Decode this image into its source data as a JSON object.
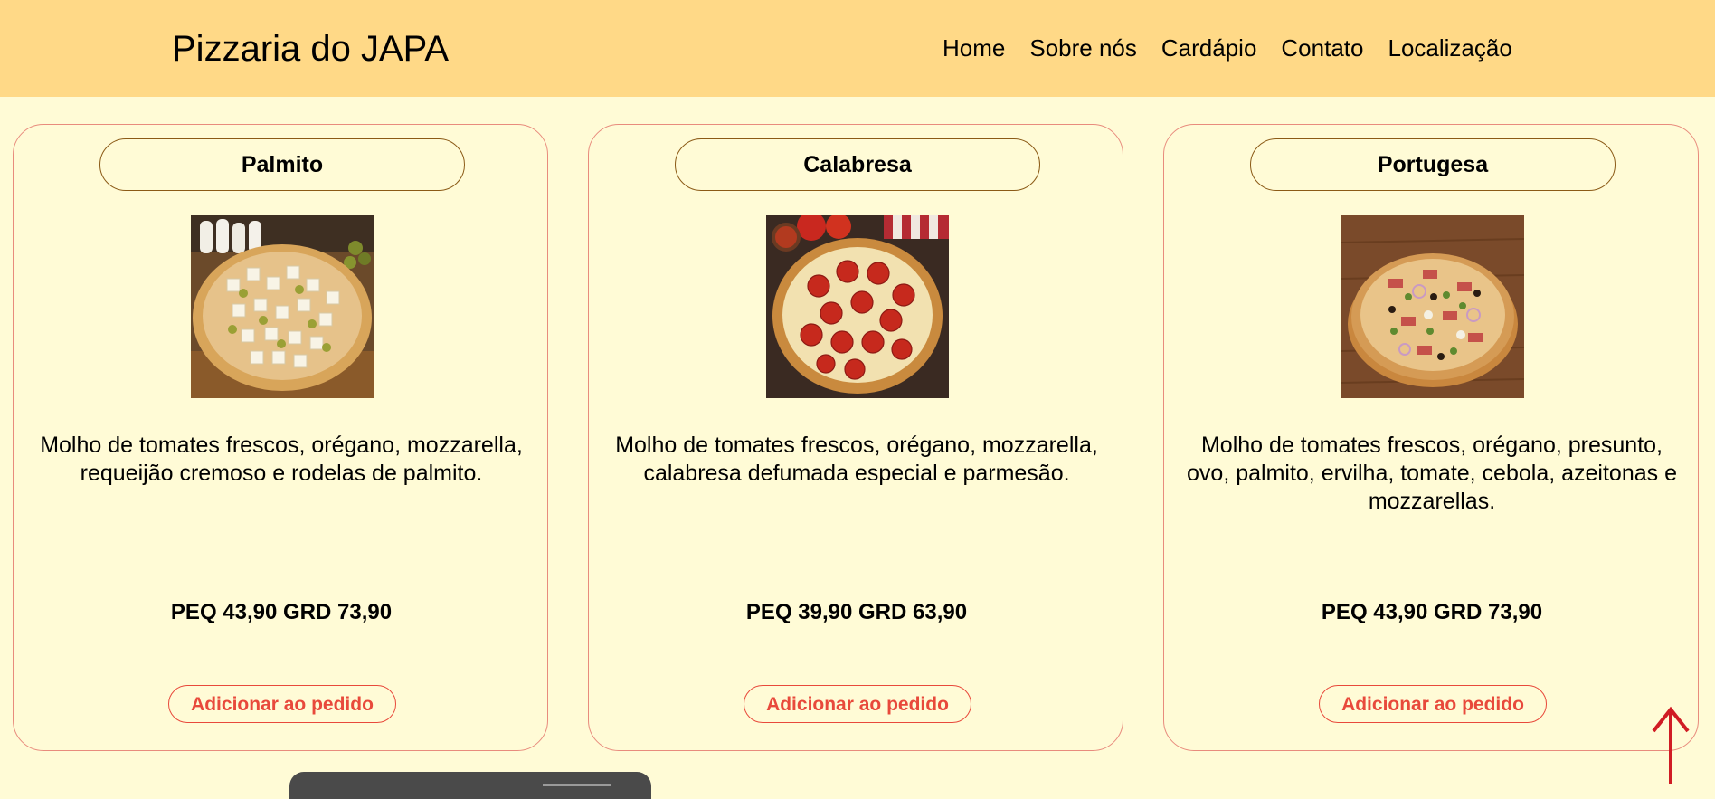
{
  "header": {
    "brand": "Pizzaria do JAPA",
    "nav": [
      "Home",
      "Sobre nós",
      "Cardápio",
      "Contato",
      "Localização"
    ]
  },
  "colors": {
    "header_bg": "#ffd987",
    "page_bg": "#fffbd6",
    "card_border": "#e88b7d",
    "title_border": "#8b5a16",
    "accent": "#e8493b",
    "scroll_arrow": "#d01c24"
  },
  "products": [
    {
      "name": "Palmito",
      "image": "pizza-palmito-image",
      "description": "Molho de tomates frescos, orégano, mozzarella, requeijão cremoso e rodelas de palmito.",
      "price": "PEQ 43,90 GRD 73,90",
      "button": "Adicionar ao pedido"
    },
    {
      "name": "Calabresa",
      "image": "pizza-calabresa-image",
      "description": "Molho de tomates frescos, orégano, mozzarella, calabresa defumada especial e parmesão.",
      "price": "PEQ 39,90 GRD 63,90",
      "button": "Adicionar ao pedido"
    },
    {
      "name": "Portugesa",
      "image": "pizza-portugesa-image",
      "description": "Molho de tomates frescos, orégano, presunto, ovo, palmito, ervilha, tomate, cebola, azeitonas e mozzarellas.",
      "price": "PEQ 43,90 GRD 73,90",
      "button": "Adicionar ao pedido"
    }
  ],
  "icons": {
    "scroll_top": "arrow-up-icon"
  }
}
